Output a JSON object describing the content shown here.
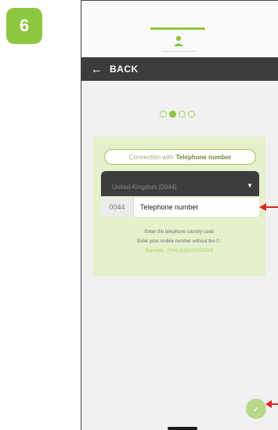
{
  "step": {
    "number": "6"
  },
  "nav": {
    "back_label": "BACK"
  },
  "progress": {
    "total_steps": 4,
    "current_step": 2
  },
  "form": {
    "mode_prefix": "Connection with",
    "mode_bold": "Telephone number",
    "country_value": "United-Kingdom (0044)",
    "dial_code": "0044",
    "phone_placeholder": "Telephone number",
    "instruction_1": "Enter the telephone country code",
    "instruction_2": "Enter your mobile number without the 0 :",
    "example": "Exemple : 0044 (0)XXXXXXXXX"
  },
  "icons": {
    "back": "arrow-left-icon",
    "profile": "person-icon",
    "dropdown": "caret-down-icon",
    "confirm": "check-icon",
    "annotation": "red-arrow-icon"
  },
  "colors": {
    "accent": "#8dc63f",
    "nav_bg": "#3c3c3c",
    "panel_bg": "#e5f0cc",
    "annotation": "#e02424"
  }
}
